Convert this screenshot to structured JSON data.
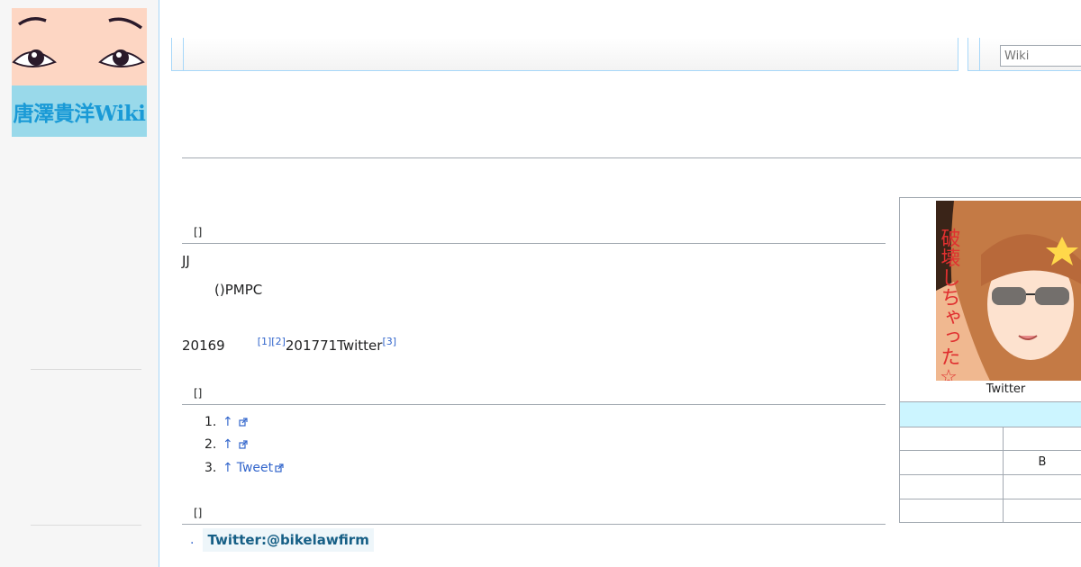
{
  "logo": {
    "text": "唐澤貴洋Wiki"
  },
  "search": {
    "placeholder": "Wiki"
  },
  "sections": {
    "section1_edit": "[]",
    "section2_edit": "[]",
    "section3_edit": "[]"
  },
  "body": {
    "line1": "JJ",
    "line2": "()PMPC",
    "line3_a": "20169",
    "line3_refs": "[1][2]",
    "line3_b": "201771Twitter",
    "line3_ref3": "[3]"
  },
  "references": [
    {
      "num": "1.",
      "arrow": "↑",
      "text": ""
    },
    {
      "num": "2.",
      "arrow": "↑",
      "text": ""
    },
    {
      "num": "3.",
      "arrow": "↑",
      "text": "Tweet"
    }
  ],
  "external_links": [
    {
      "bullet": ".",
      "label": "Twitter:@bikelawfirm"
    }
  ],
  "infobox": {
    "image_text": "破壊しちゃった☆",
    "caption": "Twitter",
    "rows": [
      "",
      "B",
      "",
      ""
    ]
  },
  "colors": {
    "link": "#3366cc",
    "border_blue": "#a7d7f9",
    "infobox_band": "#ccf5ff",
    "logo_face": "#fdd6c3",
    "logo_band": "#99d9ea"
  }
}
